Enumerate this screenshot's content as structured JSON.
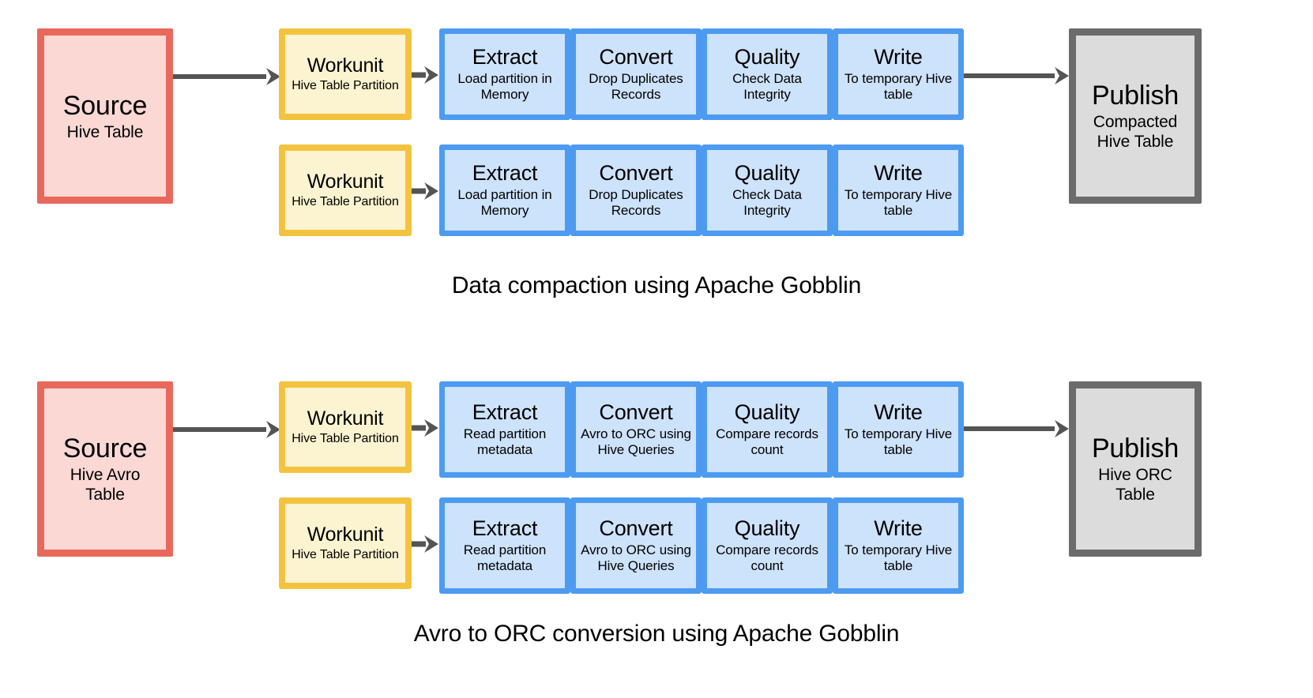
{
  "diagrams": [
    {
      "caption": "Data compaction using Apache Gobblin",
      "source": {
        "title": "Source",
        "sub": "Hive Table"
      },
      "publish": {
        "title": "Publish",
        "sub_line1": "Compacted",
        "sub_line2": "Hive Table"
      },
      "workunits": [
        {
          "title": "Workunit",
          "sub": "Hive Table Partition"
        },
        {
          "title": "Workunit",
          "sub": "Hive Table Partition"
        }
      ],
      "pipelines": [
        [
          {
            "title": "Extract",
            "sub_line1": "Load partition in",
            "sub_line2": "Memory"
          },
          {
            "title": "Convert",
            "sub_line1": "Drop Duplicates",
            "sub_line2": "Records"
          },
          {
            "title": "Quality",
            "sub_line1": "Check Data",
            "sub_line2": "Integrity"
          },
          {
            "title": "Write",
            "sub_line1": "To temporary Hive",
            "sub_line2": "table"
          }
        ],
        [
          {
            "title": "Extract",
            "sub_line1": "Load partition in",
            "sub_line2": "Memory"
          },
          {
            "title": "Convert",
            "sub_line1": "Drop Duplicates",
            "sub_line2": "Records"
          },
          {
            "title": "Quality",
            "sub_line1": "Check Data",
            "sub_line2": "Integrity"
          },
          {
            "title": "Write",
            "sub_line1": "To temporary Hive",
            "sub_line2": "table"
          }
        ]
      ]
    },
    {
      "caption": "Avro to ORC conversion using Apache Gobblin",
      "source": {
        "title": "Source",
        "sub_line1": "Hive Avro",
        "sub_line2": "Table"
      },
      "publish": {
        "title": "Publish",
        "sub_line1": "Hive ORC",
        "sub_line2": "Table"
      },
      "workunits": [
        {
          "title": "Workunit",
          "sub": "Hive Table Partition"
        },
        {
          "title": "Workunit",
          "sub": "Hive Table Partition"
        }
      ],
      "pipelines": [
        [
          {
            "title": "Extract",
            "sub_line1": "Read partition",
            "sub_line2": "metadata"
          },
          {
            "title": "Convert",
            "sub_line1": "Avro to ORC using",
            "sub_line2": "Hive Queries"
          },
          {
            "title": "Quality",
            "sub_line1": "Compare records",
            "sub_line2": "count"
          },
          {
            "title": "Write",
            "sub_line1": "To temporary Hive",
            "sub_line2": "table"
          }
        ],
        [
          {
            "title": "Extract",
            "sub_line1": "Read partition",
            "sub_line2": "metadata"
          },
          {
            "title": "Convert",
            "sub_line1": "Avro to ORC using",
            "sub_line2": "Hive Queries"
          },
          {
            "title": "Quality",
            "sub_line1": "Compare records",
            "sub_line2": "count"
          },
          {
            "title": "Write",
            "sub_line1": "To temporary Hive",
            "sub_line2": "table"
          }
        ]
      ]
    }
  ],
  "colors": {
    "source_border": "#e8695c",
    "source_fill": "#fbd8d4",
    "workunit_border": "#f3c33f",
    "workunit_fill": "#fcf3d0",
    "stage_border": "#4d9bf0",
    "stage_fill": "#cde2fb",
    "publish_border": "#6b6b6b",
    "publish_fill": "#dcdcdc",
    "arrow": "#545454",
    "background": "#ffffff",
    "text": "#000000"
  }
}
